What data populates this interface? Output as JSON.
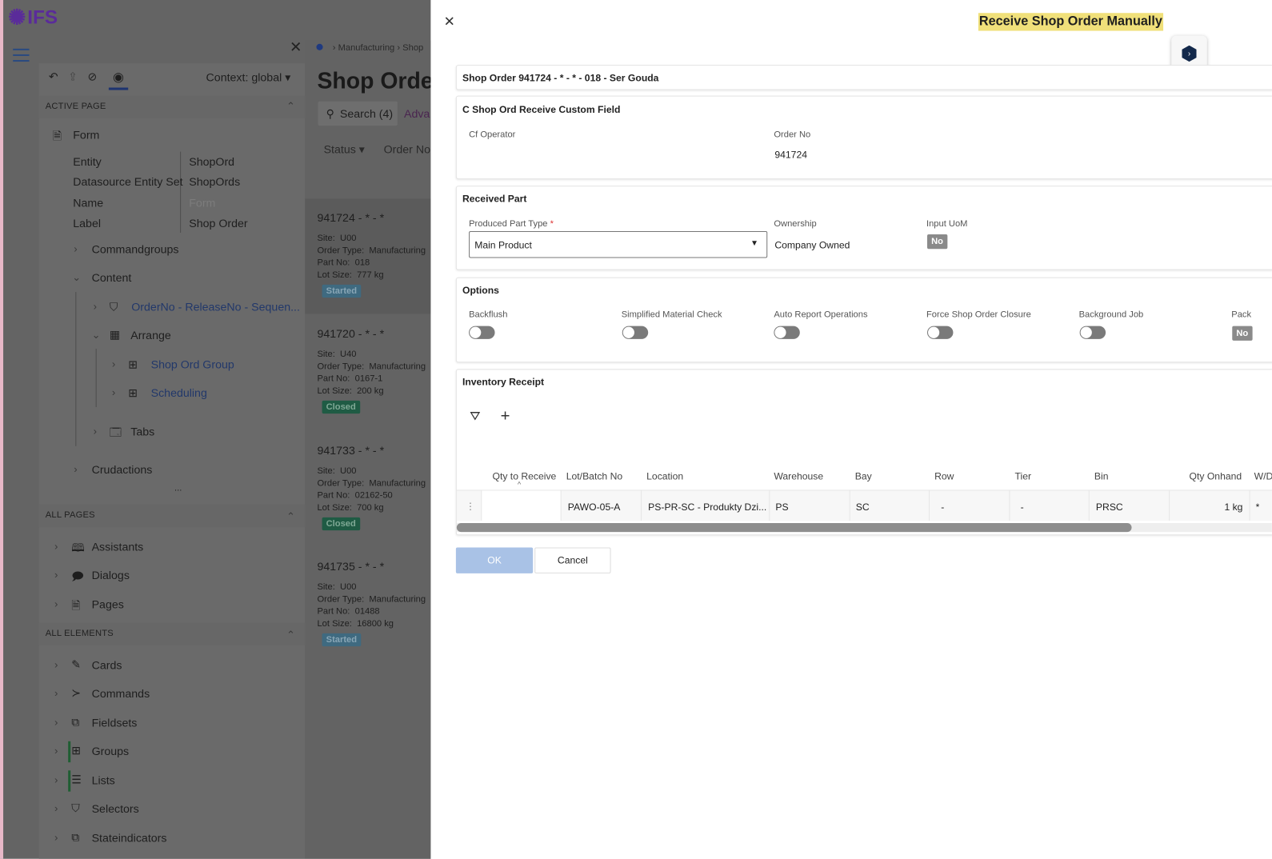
{
  "app": {
    "logo": "IFS"
  },
  "sidebar": {
    "context": "Context: global",
    "active_page": {
      "title": "ACTIVE PAGE",
      "root": "Form",
      "props": [
        {
          "k": "Entity",
          "v": "ShopOrd"
        },
        {
          "k": "Datasource Entity Set",
          "v": "ShopOrds"
        },
        {
          "k": "Name",
          "v": "Form"
        },
        {
          "k": "Label",
          "v": "Shop Order"
        }
      ],
      "tree": {
        "commandgroups": "Commandgroups",
        "content": "Content",
        "selector": "OrderNo - ReleaseNo - Sequen...",
        "arrange": "Arrange",
        "group1": "Shop Ord Group",
        "group2": "Scheduling",
        "tabs": "Tabs",
        "crudactions": "Crudactions",
        "more": "..."
      }
    },
    "all_pages": {
      "title": "ALL PAGES",
      "items": [
        "Assistants",
        "Dialogs",
        "Pages"
      ]
    },
    "all_elements": {
      "title": "ALL ELEMENTS",
      "items": [
        "Cards",
        "Commands",
        "Fieldsets",
        "Groups",
        "Lists",
        "Selectors",
        "Stateindicators"
      ]
    }
  },
  "page": {
    "breadcrumb": [
      "Manufacturing",
      "Shop"
    ],
    "title": "Shop Order",
    "search": "Search (4)",
    "advanced": "Adva",
    "filters": [
      "Status",
      "Order No"
    ],
    "cards": [
      {
        "title": "941724 - * - *",
        "site": "U00",
        "type": "Manufacturing",
        "part": "018",
        "lot": "777 kg",
        "status": "Started"
      },
      {
        "title": "941720 - * - *",
        "site": "U40",
        "type": "Manufacturing",
        "part": "0167-1",
        "lot": "200 kg",
        "status": "Closed"
      },
      {
        "title": "941733 - * - *",
        "site": "U00",
        "type": "Manufacturing",
        "part": "02162-50",
        "lot": "700 kg",
        "status": "Closed"
      },
      {
        "title": "941735 - * - *",
        "site": "U00",
        "type": "Manufacturing",
        "part": "01488",
        "lot": "16800 kg",
        "status": "Started"
      }
    ],
    "labels": {
      "site": "Site:",
      "type": "Order Type:",
      "part": "Part No:",
      "lot": "Lot Size:"
    }
  },
  "dialog": {
    "title": "Receive Shop Order Manually",
    "header": "Shop Order 941724 - * - * - 018 - Ser Gouda",
    "custom": {
      "title": "C Shop Ord Receive Custom Field",
      "cf_operator": "Cf Operator",
      "order_no_label": "Order No",
      "order_no": "941724"
    },
    "received": {
      "title": "Received Part",
      "ppt_label": "Produced Part Type",
      "required": "*",
      "ppt_value": "Main Product",
      "ownership_label": "Ownership",
      "ownership": "Company Owned",
      "uom_label": "Input UoM",
      "uom": "No"
    },
    "options": {
      "title": "Options",
      "items": [
        "Backflush",
        "Simplified Material Check",
        "Auto Report Operations",
        "Force Shop Order Closure",
        "Background Job"
      ],
      "pack_label": "Pack",
      "pack": "No"
    },
    "inventory": {
      "title": "Inventory Receipt",
      "columns": [
        "Qty to Receive",
        "Lot/Batch No",
        "Location",
        "Warehouse",
        "Bay",
        "Row",
        "Tier",
        "Bin",
        "Qty Onhand",
        "W/D"
      ],
      "row": [
        "",
        "PAWO-05-A",
        "PS-PR-SC - Produkty Dzi...",
        "PS",
        "SC",
        "-",
        "-",
        "PRSC",
        "1 kg",
        "*"
      ]
    },
    "ok": "OK",
    "cancel": "Cancel"
  }
}
